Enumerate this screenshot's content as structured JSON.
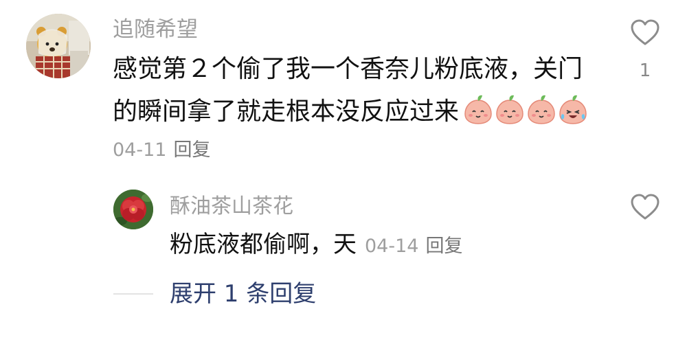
{
  "main_comment": {
    "username": "追随希望",
    "line1": "感觉第２个偷了我一个香奈儿粉底液，关门",
    "line2": "的瞬间拿了就走根本没反应过来",
    "emojis": [
      "smile-peach-icon",
      "smile-peach-icon",
      "smile-peach-icon",
      "cry-laugh-peach-icon"
    ],
    "date": "04-11",
    "reply_label": "回复",
    "like_count": "1"
  },
  "reply_comment": {
    "username": "酥油茶山茶花",
    "text": "粉底液都偷啊，天",
    "date": "04-14",
    "reply_label": "回复"
  },
  "expand": {
    "label": "展开 1 条回复"
  },
  "colors": {
    "username": "#9e9e9e",
    "text": "#111111",
    "expand_link": "#2e3f6e",
    "heart_stroke": "#8c8c8c"
  }
}
